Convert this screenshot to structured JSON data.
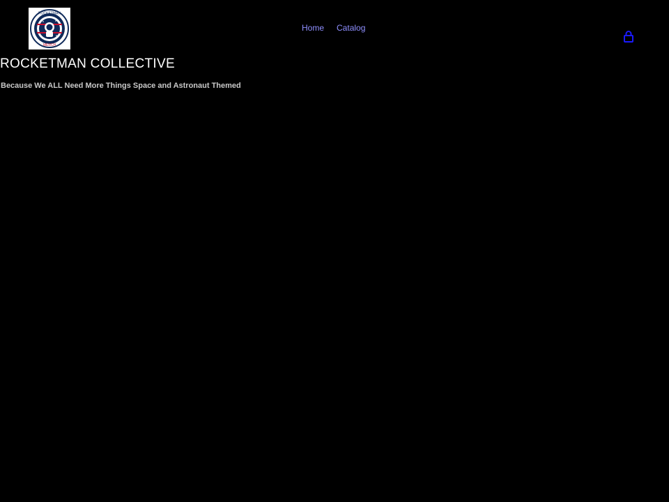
{
  "header": {
    "logo": {
      "icon": "rocketman-badge-icon",
      "badge_text_top": "ROCKETMAN",
      "badge_text_bottom": "MERCH"
    },
    "nav": [
      {
        "label": "Home"
      },
      {
        "label": "Catalog"
      }
    ],
    "cart": {
      "icon": "cart-icon"
    }
  },
  "hero": {
    "title": "ROCKETMAN COLLECTIVE",
    "tagline": "Because We ALL Need More Things Space and Astronaut Themed"
  },
  "colors": {
    "background": "#000000",
    "link": "#8f8fff",
    "cart_icon": "#1a1aff",
    "badge_red": "#c8102e",
    "badge_navy": "#0f2a5a"
  }
}
